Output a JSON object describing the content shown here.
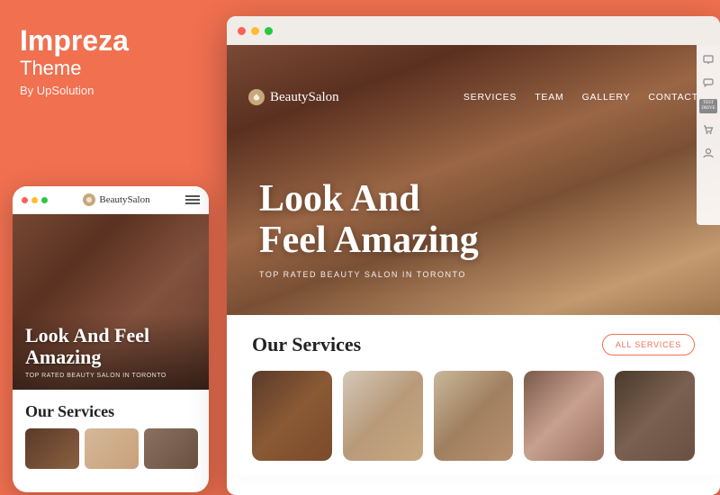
{
  "background": {
    "color": "#f07050"
  },
  "left_panel": {
    "theme_name": "Impreza",
    "theme_label": "Theme",
    "by_text": "By UpSolution"
  },
  "mobile_mockup": {
    "dots": [
      {
        "color": "#ff5f57"
      },
      {
        "color": "#ffbd2e"
      },
      {
        "color": "#28c940"
      }
    ],
    "logo_text": "BeautySalon",
    "hero_title": "Look And Feel Amazing",
    "hero_subtitle": "TOP RATED BEAUTY SALON IN TORONTO",
    "services_title": "Our Services"
  },
  "desktop_mockup": {
    "dots": [
      {
        "color": "#ff5f57"
      },
      {
        "color": "#ffbd2e"
      },
      {
        "color": "#28c940"
      }
    ],
    "nav": {
      "logo_text": "BeautySalon",
      "links": [
        "SERVICES",
        "TEAM",
        "GALLERY",
        "CONTACT"
      ]
    },
    "hero": {
      "title_line1": "Look And",
      "title_line2": "Feel Amazing",
      "subtitle": "TOP RATED BEAUTY SALON IN TORONTO"
    },
    "toolbar": {
      "icons": [
        "monitor-icon",
        "chat-icon",
        "test-drive-icon",
        "cart-icon",
        "user-icon"
      ],
      "test_drive_text": "TEST DRIVE"
    },
    "services": {
      "title": "Our Services",
      "button_label": "ALL SERVICES",
      "cards": [
        {
          "id": 1,
          "class": "sc1"
        },
        {
          "id": 2,
          "class": "sc2"
        },
        {
          "id": 3,
          "class": "sc3"
        },
        {
          "id": 4,
          "class": "sc4"
        },
        {
          "id": 5,
          "class": "sc5"
        }
      ]
    }
  }
}
